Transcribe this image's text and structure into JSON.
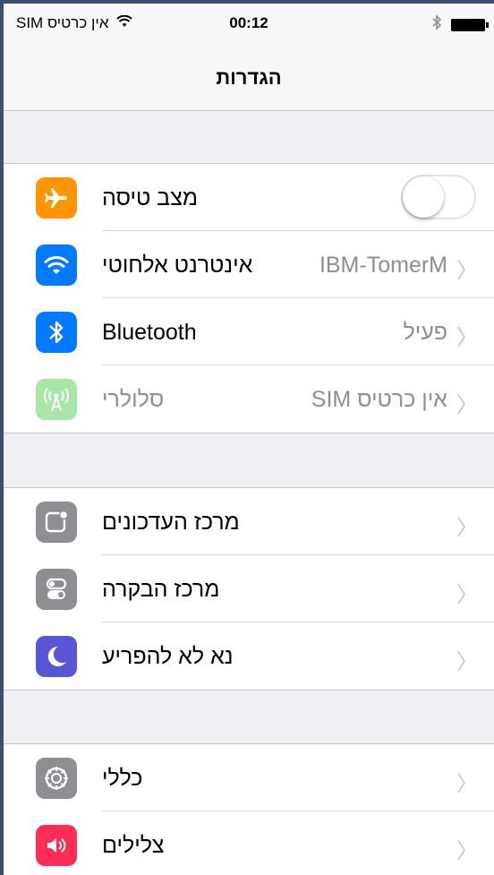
{
  "status": {
    "carrier": "SIM אין כרטיס",
    "time": "00:12"
  },
  "nav": {
    "title": "הגדרות"
  },
  "group1": {
    "airplane": {
      "label": "מצב טיסה",
      "on": false
    },
    "wifi": {
      "label": "אינטרנט אלחוטי",
      "value": "IBM-TomerM"
    },
    "bluetooth": {
      "label": "Bluetooth",
      "value": "פעיל"
    },
    "cellular": {
      "label": "סלולרי",
      "value": "SIM אין כרטיס"
    }
  },
  "group2": {
    "notifications": {
      "label": "מרכז העדכונים"
    },
    "control": {
      "label": "מרכז הבקרה"
    },
    "dnd": {
      "label": "נא לא להפריע"
    }
  },
  "group3": {
    "general": {
      "label": "כללי"
    },
    "sounds": {
      "label": "צלילים"
    }
  },
  "colors": {
    "airplane": "#ff9500",
    "wifi": "#007aff",
    "bluetooth": "#007aff",
    "cellular": "#a8e6a8",
    "notifications": "#8e8e93",
    "control": "#8e8e93",
    "dnd": "#5856d6",
    "general": "#8e8e93",
    "sounds": "#ff2d55"
  }
}
